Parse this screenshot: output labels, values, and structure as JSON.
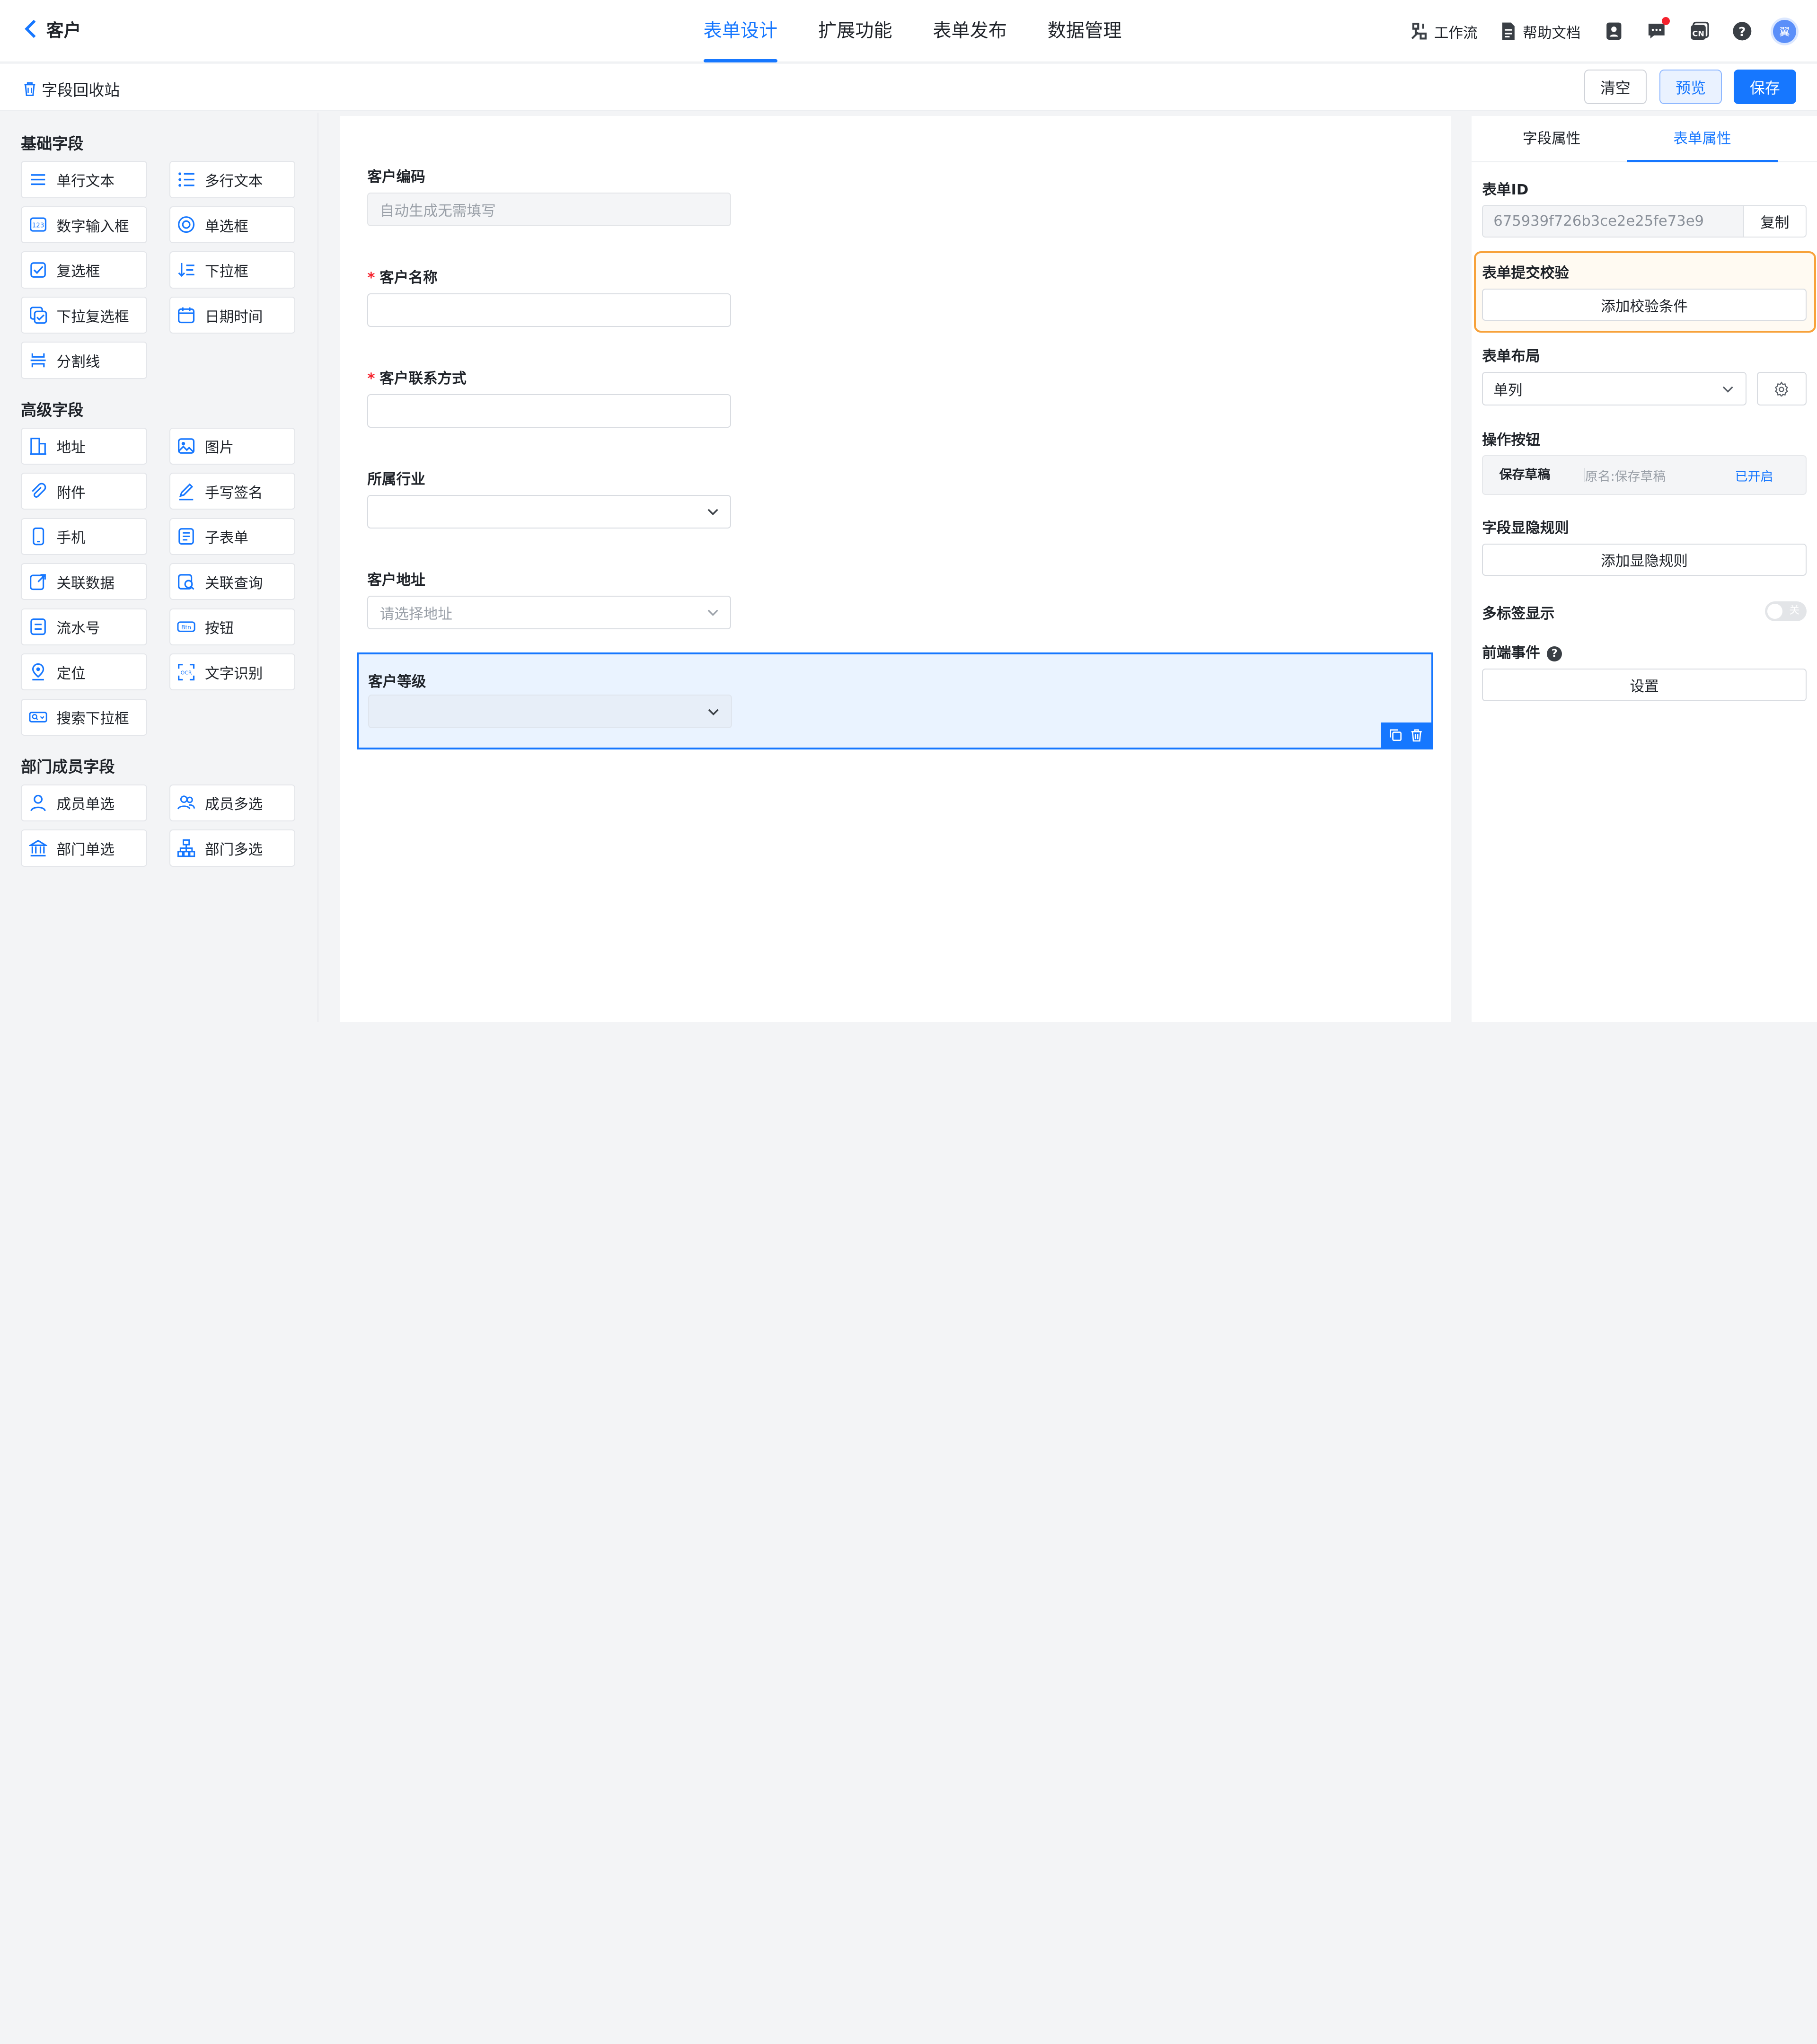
{
  "header": {
    "back_label": "客户",
    "tabs": [
      "表单设计",
      "扩展功能",
      "表单发布",
      "数据管理"
    ],
    "active_tab": "表单设计",
    "tools": {
      "workflow": "工作流",
      "help_docs": "帮助文档"
    },
    "avatar_text": "翼"
  },
  "subbar": {
    "recycle": "字段回收站",
    "clear": "清空",
    "preview": "预览",
    "save": "保存"
  },
  "palette": {
    "basic_title": "基础字段",
    "basic": [
      {
        "label": "单行文本",
        "icon": "single-line-text-icon"
      },
      {
        "label": "多行文本",
        "icon": "multi-line-text-icon"
      },
      {
        "label": "数字输入框",
        "icon": "number-input-icon"
      },
      {
        "label": "单选框",
        "icon": "radio-icon"
      },
      {
        "label": "复选框",
        "icon": "checkbox-icon"
      },
      {
        "label": "下拉框",
        "icon": "dropdown-icon"
      },
      {
        "label": "下拉复选框",
        "icon": "dropdown-checkbox-icon"
      },
      {
        "label": "日期时间",
        "icon": "calendar-icon"
      },
      {
        "label": "分割线",
        "icon": "divider-icon"
      }
    ],
    "advanced_title": "高级字段",
    "advanced": [
      {
        "label": "地址",
        "icon": "building-icon"
      },
      {
        "label": "图片",
        "icon": "image-icon"
      },
      {
        "label": "附件",
        "icon": "attachment-icon"
      },
      {
        "label": "手写签名",
        "icon": "signature-icon"
      },
      {
        "label": "手机",
        "icon": "phone-icon"
      },
      {
        "label": "子表单",
        "icon": "subform-icon"
      },
      {
        "label": "关联数据",
        "icon": "link-data-icon"
      },
      {
        "label": "关联查询",
        "icon": "link-query-icon"
      },
      {
        "label": "流水号",
        "icon": "serial-number-icon"
      },
      {
        "label": "按钮",
        "icon": "button-icon"
      },
      {
        "label": "定位",
        "icon": "location-icon"
      },
      {
        "label": "文字识别",
        "icon": "ocr-icon"
      },
      {
        "label": "搜索下拉框",
        "icon": "search-dropdown-icon"
      }
    ],
    "member_title": "部门成员字段",
    "member": [
      {
        "label": "成员单选",
        "icon": "user-icon"
      },
      {
        "label": "成员多选",
        "icon": "users-icon"
      },
      {
        "label": "部门单选",
        "icon": "department-icon"
      },
      {
        "label": "部门多选",
        "icon": "org-chart-icon"
      }
    ]
  },
  "form": {
    "fields": [
      {
        "label": "客户编码",
        "required": false,
        "placeholder": "自动生成无需填写",
        "type": "disabled"
      },
      {
        "label": "客户名称",
        "required": true,
        "placeholder": "",
        "type": "text"
      },
      {
        "label": "客户联系方式",
        "required": true,
        "placeholder": "",
        "type": "text"
      },
      {
        "label": "所属行业",
        "required": false,
        "placeholder": "",
        "type": "select"
      },
      {
        "label": "客户地址",
        "required": false,
        "placeholder": "请选择地址",
        "type": "select"
      },
      {
        "label": "客户等级",
        "required": false,
        "placeholder": "",
        "type": "select",
        "selected": true
      }
    ]
  },
  "props": {
    "tabs": [
      "字段属性",
      "表单属性"
    ],
    "active_tab": "表单属性",
    "form_id_label": "表单ID",
    "form_id": "675939f726b3ce2e25fe73e9",
    "copy": "复制",
    "validate_label": "表单提交校验",
    "validate_btn": "添加校验条件",
    "layout_label": "表单布局",
    "layout_value": "单列",
    "op_label": "操作按钮",
    "op_name": "保存草稿",
    "op_orig": "原名:保存草稿",
    "op_status": "已开启",
    "visibility_label": "字段显隐规则",
    "visibility_btn": "添加显隐规则",
    "multitab_label": "多标签显示",
    "multitab_toggle": "关",
    "frontend_label": "前端事件",
    "frontend_btn": "设置",
    "colors": {
      "accent": "#1677ff",
      "highlight": "#f7a23b"
    }
  }
}
